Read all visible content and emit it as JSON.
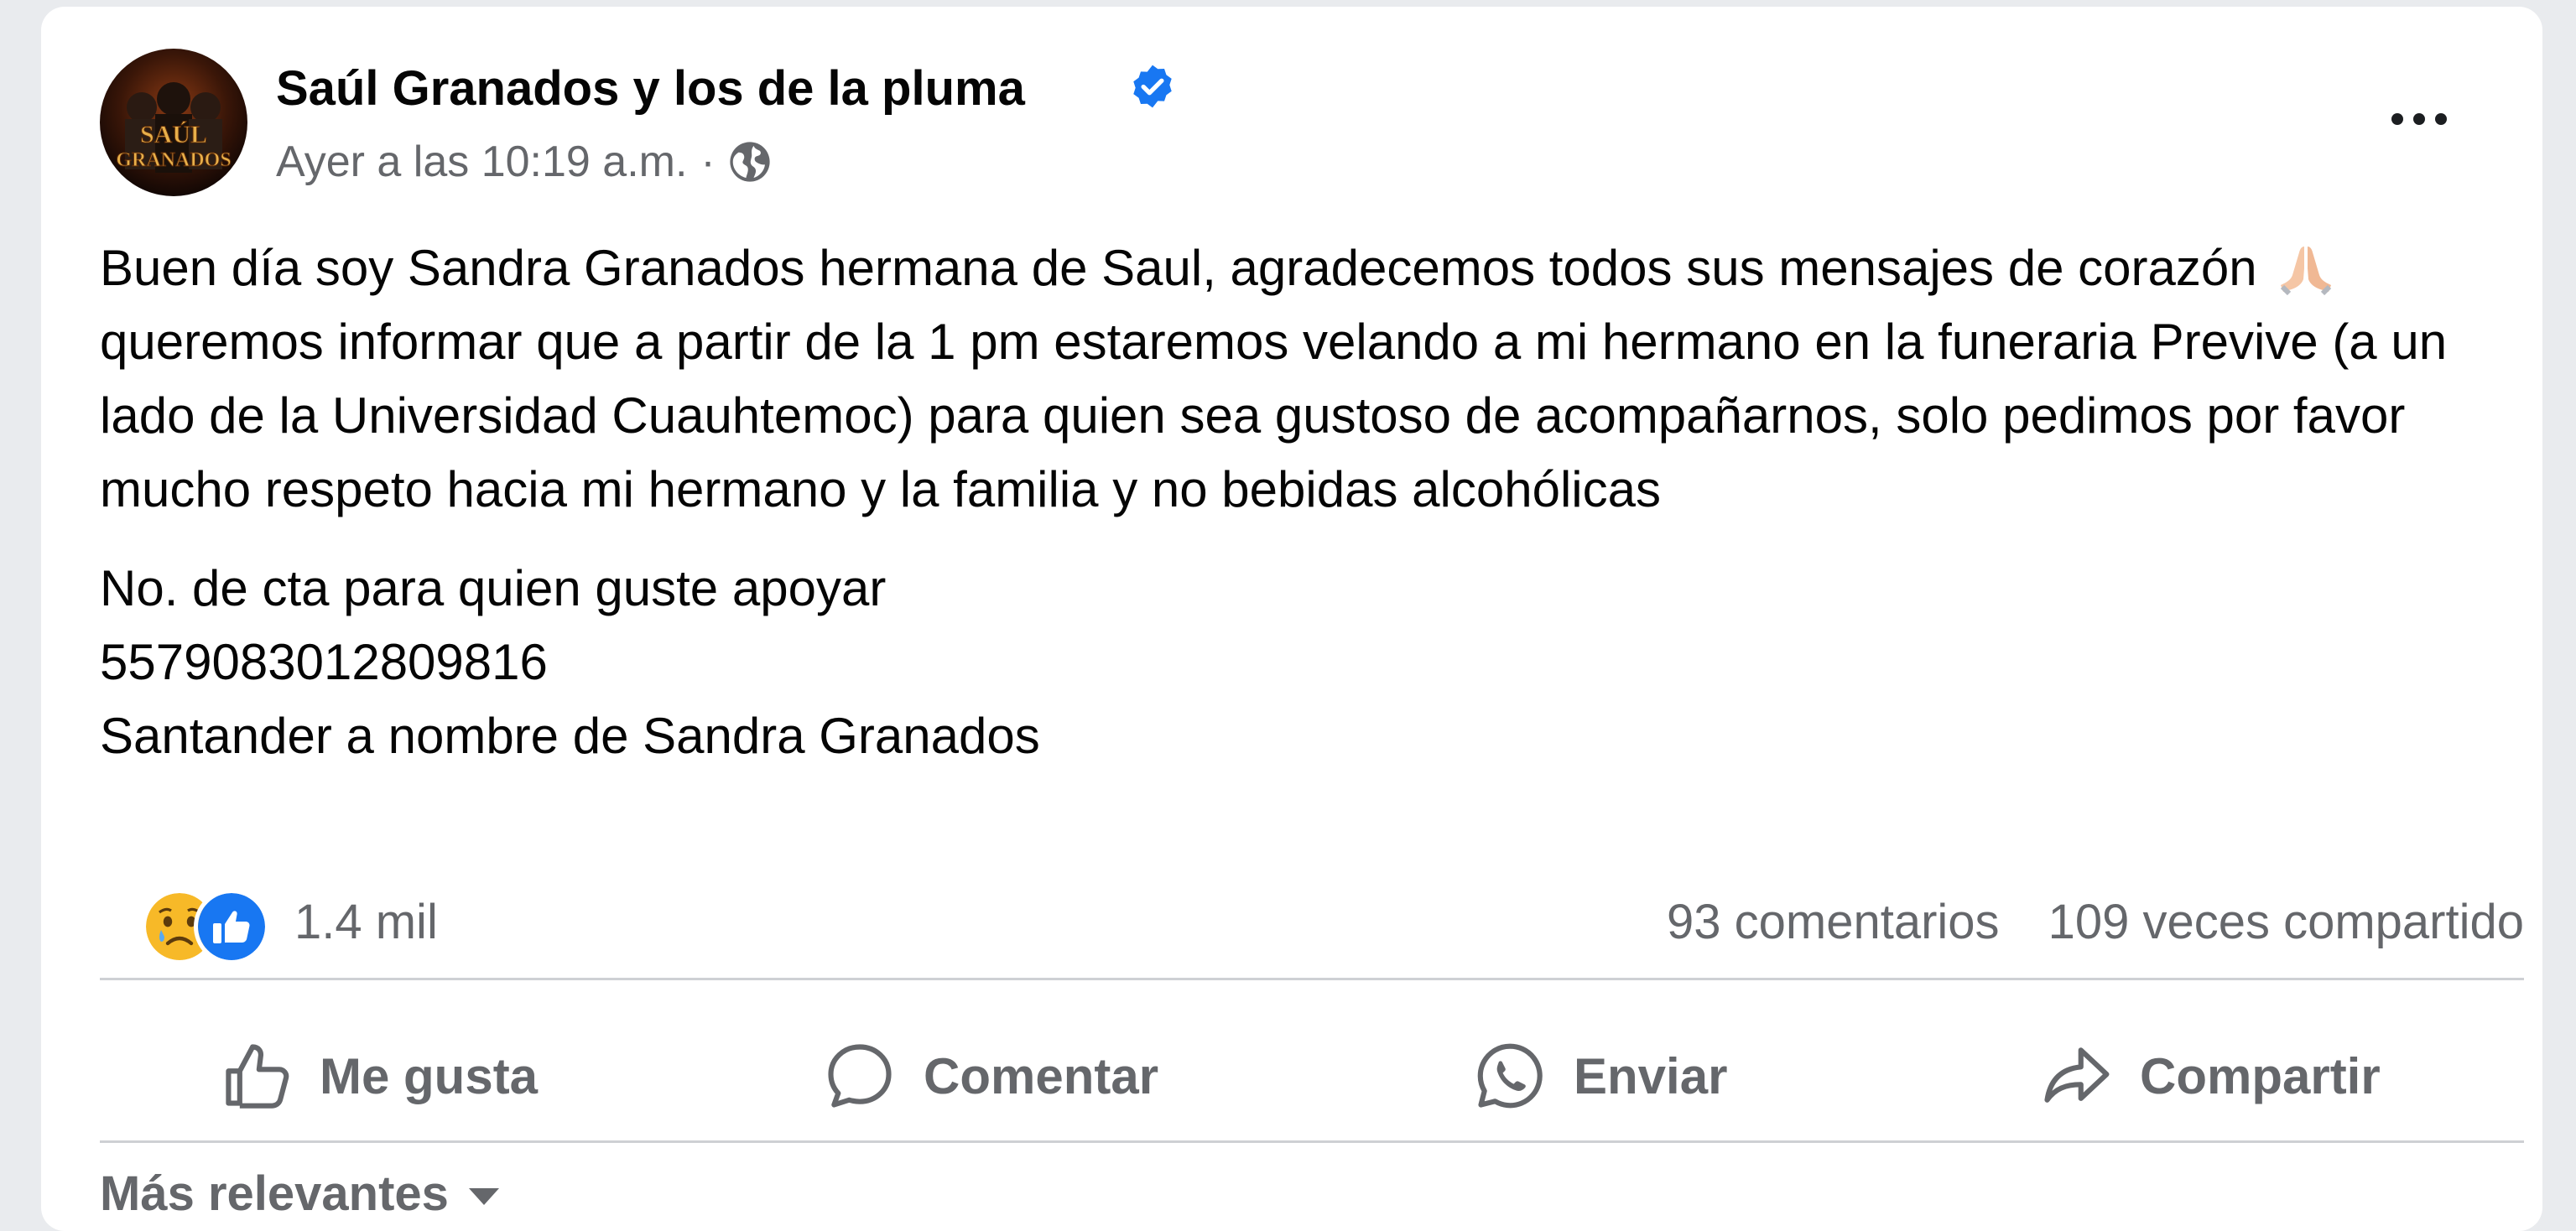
{
  "post": {
    "page_name": "Saúl Granados y los de la pluma",
    "timestamp": "Ayer a las 10:19 a.m.",
    "separator": "·",
    "avatar_text": [
      "SAÚL",
      "GRANADOS"
    ],
    "icons": {
      "verified": "verified-badge-icon",
      "audience": "globe-icon",
      "more": "more-options-icon"
    },
    "paragraph1": {
      "part1": "Buen día soy Sandra Granados hermana de Saul, agradecemos todos sus mensajes de corazón",
      "emoji": "folded-hands-emoji",
      "part2": "queremos informar que a partir de la 1 pm estaremos velando a mi hermano en la funeraria Previve (a un lado de la Universidad Cuauhtemoc) para quien sea gustoso de acompañarnos, solo pedimos por favor mucho respeto hacia mi hermano y la familia y no bebidas alcohólicas"
    },
    "paragraph2": {
      "line1": "No. de cta para quien guste apoyar",
      "line2": "5579083012809816",
      "line3": "Santander a nombre de Sandra Granados"
    }
  },
  "reactions": {
    "types": [
      "sad",
      "like"
    ],
    "count": "1.4 mil",
    "comments": "93 comentarios",
    "shares": "109 veces compartido"
  },
  "actions": {
    "like": "Me gusta",
    "comment": "Comentar",
    "send": "Enviar",
    "share": "Compartir"
  },
  "comments_sort": {
    "label": "Más relevantes"
  },
  "colors": {
    "accent": "#1877f2",
    "secondary_text": "#65676b",
    "divider": "#ced0d4",
    "sad_reaction": "#f7b928"
  }
}
